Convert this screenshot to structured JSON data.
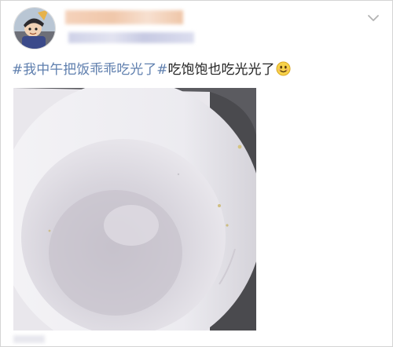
{
  "post": {
    "hashtag_1": "#我中午把饭乖乖吃光了#",
    "body_text": "吃饱饱也吃光光了",
    "emoji_name": "smile-emoji-icon"
  },
  "header": {
    "avatar_icon": "avatar",
    "menu_icon": "chevron-down-icon"
  },
  "colors": {
    "hashtag": "#5f7fae",
    "text": "#222222",
    "username_blur": "#f3c7a8",
    "meta_blur": "#c9cbe4"
  },
  "image": {
    "subject_icon": "empty-bowl-photo"
  }
}
